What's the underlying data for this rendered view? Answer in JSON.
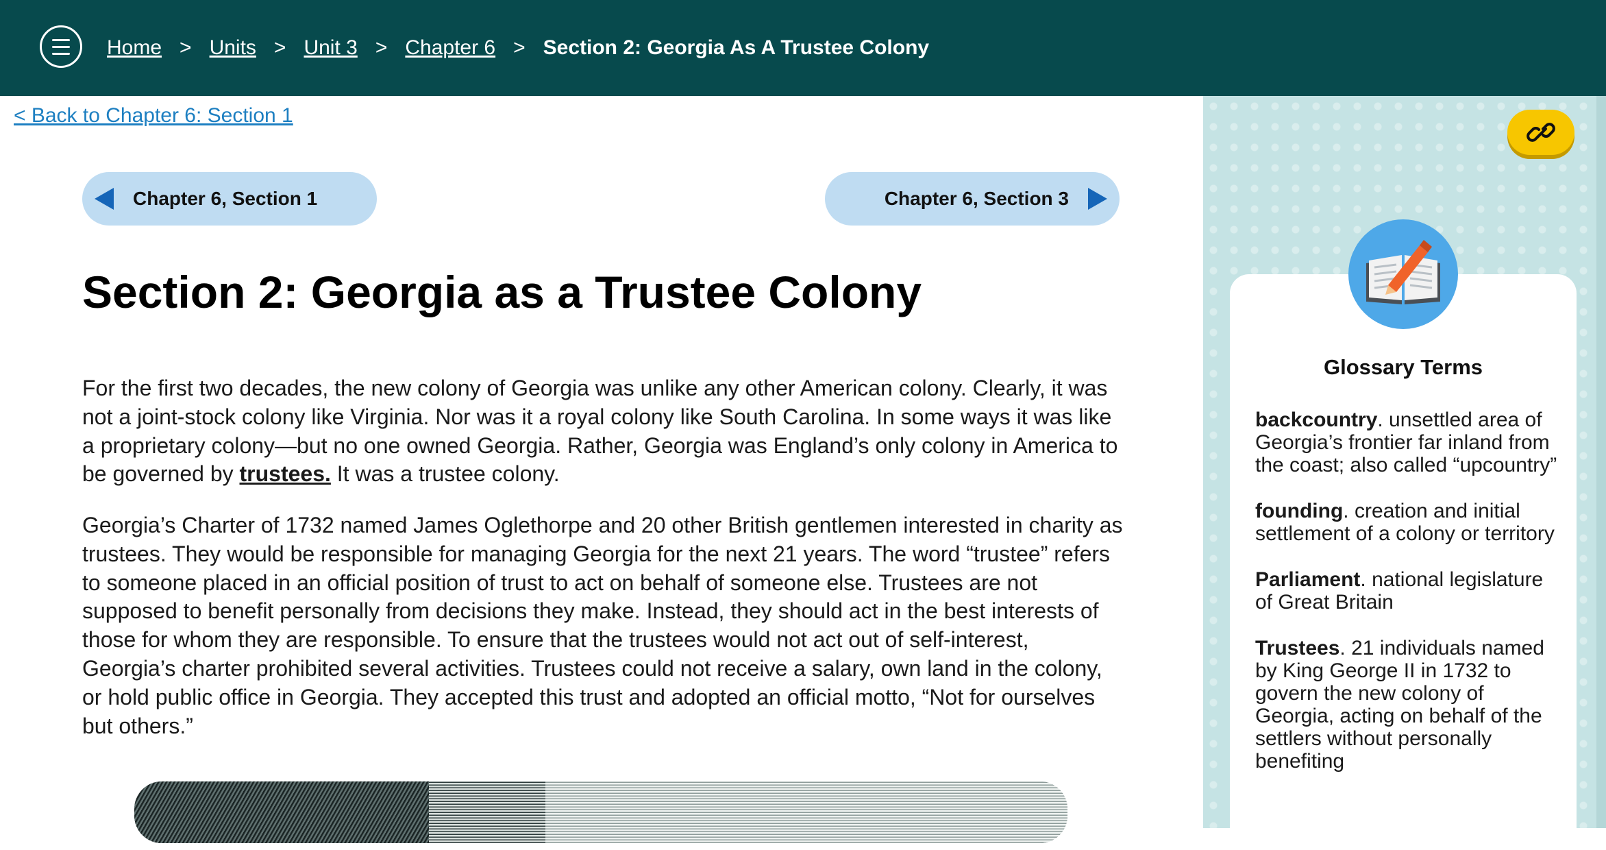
{
  "header": {
    "breadcrumbs": [
      {
        "label": "Home"
      },
      {
        "label": "Units"
      },
      {
        "label": "Unit 3"
      },
      {
        "label": "Chapter 6"
      }
    ],
    "separator": ">",
    "current": "Section 2: Georgia As A Trustee Colony",
    "bg_color": "#074a4d"
  },
  "back_link": "< Back to Chapter 6: Section 1",
  "nav": {
    "prev_label": "Chapter 6, Section 1",
    "next_label": "Chapter 6, Section 3"
  },
  "main": {
    "title": "Section 2: Georgia as a Trustee Colony",
    "paragraph1": {
      "before": "For the first two decades, the new colony of Georgia was unlike any other American colony. Clearly, it was not a joint-stock colony like Virginia. Nor was it a royal colony like South Carolina. In some ways it was like a proprietary colony—but no one owned Georgia. Rather, Georgia was England’s only colony in America to be governed by ",
      "term": "trustees.",
      "after": " It was a trustee colony."
    },
    "paragraph2": "Georgia’s Charter of 1732 named James Oglethorpe and 20 other British gentlemen interested in charity as trustees. They would be responsible for managing Georgia for the next 21 years. The word “trustee” refers to someone placed in an official position of trust to act on behalf of someone else. Trustees are not supposed to benefit personally from decisions they make. Instead, they should act in the best interests of those for whom they are responsible. To ensure that the trustees would not act out of self-interest, Georgia’s charter prohibited several activities. Trustees could not receive a salary, own land in the colony, or hold public office in Georgia. They accepted this trust and adopted an official motto, “Not for ourselves but others.”"
  },
  "glossary": {
    "title": "Glossary Terms",
    "icon": "open-book-pencil-icon",
    "terms": [
      {
        "term": "backcountry",
        "definition": ". unsettled area of Georgia’s frontier far inland from the coast; also called “upcountry”"
      },
      {
        "term": "founding",
        "definition": ". creation and initial settlement of a colony or territory"
      },
      {
        "term": "Parliament",
        "definition": ". national legislature of Great Britain"
      },
      {
        "term": "Trustees",
        "definition": ". 21 individuals named by King George II in 1732 to govern the new colony of Georgia, acting on behalf of the settlers without personally benefiting"
      }
    ]
  },
  "colors": {
    "link": "#1d7fc1",
    "nav_pill": "#bfdcf2",
    "nav_arrow": "#1565b8",
    "sidebar": "#c5e3e4",
    "link_button": "#f7c600",
    "glossary_icon_bg": "#4ea8e8"
  }
}
